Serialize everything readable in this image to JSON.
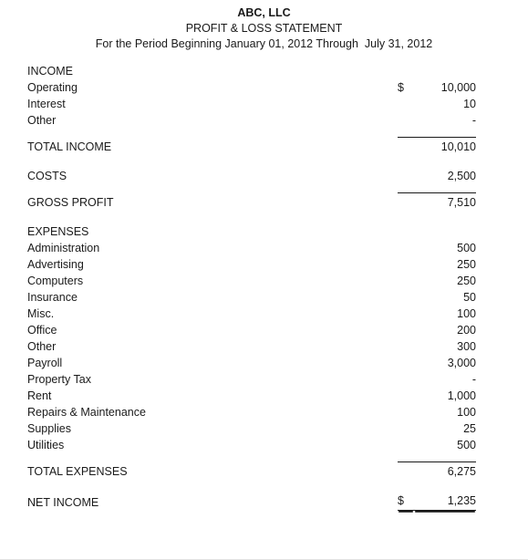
{
  "header": {
    "company": "ABC, LLC",
    "statement_title": "PROFIT & LOSS STATEMENT",
    "period": "For the Period Beginning January 01, 2012 Through  July 31, 2012"
  },
  "currency_symbol": "$",
  "income": {
    "caption": "INCOME",
    "rows": [
      {
        "label": "Operating",
        "symbol": "$",
        "amount": "10,000"
      },
      {
        "label": "Interest",
        "symbol": "",
        "amount": "10"
      },
      {
        "label": "Other",
        "symbol": "",
        "amount": "-"
      }
    ],
    "total": {
      "label": "TOTAL INCOME",
      "symbol": "",
      "amount": "10,010"
    }
  },
  "costs": {
    "label": "COSTS",
    "symbol": "",
    "amount": "2,500"
  },
  "gross_profit": {
    "label": "GROSS PROFIT",
    "symbol": "",
    "amount": "7,510"
  },
  "expenses": {
    "caption": "EXPENSES",
    "rows": [
      {
        "label": "Administration",
        "symbol": "",
        "amount": "500"
      },
      {
        "label": "Advertising",
        "symbol": "",
        "amount": "250"
      },
      {
        "label": "Computers",
        "symbol": "",
        "amount": "250"
      },
      {
        "label": "Insurance",
        "symbol": "",
        "amount": "50"
      },
      {
        "label": "Misc.",
        "symbol": "",
        "amount": "100"
      },
      {
        "label": "Office",
        "symbol": "",
        "amount": "200"
      },
      {
        "label": "Other",
        "symbol": "",
        "amount": "300"
      },
      {
        "label": "Payroll",
        "symbol": "",
        "amount": "3,000"
      },
      {
        "label": "Property Tax",
        "symbol": "",
        "amount": "-"
      },
      {
        "label": "Rent",
        "symbol": "",
        "amount": "1,000"
      },
      {
        "label": "Repairs & Maintenance",
        "symbol": "",
        "amount": "100"
      },
      {
        "label": "Supplies",
        "symbol": "",
        "amount": "25"
      },
      {
        "label": "Utilities",
        "symbol": "",
        "amount": "500"
      }
    ],
    "total": {
      "label": "TOTAL EXPENSES",
      "symbol": "",
      "amount": "6,275"
    }
  },
  "net_income": {
    "label": "NET INCOME",
    "symbol": "$",
    "amount": "1,235"
  }
}
